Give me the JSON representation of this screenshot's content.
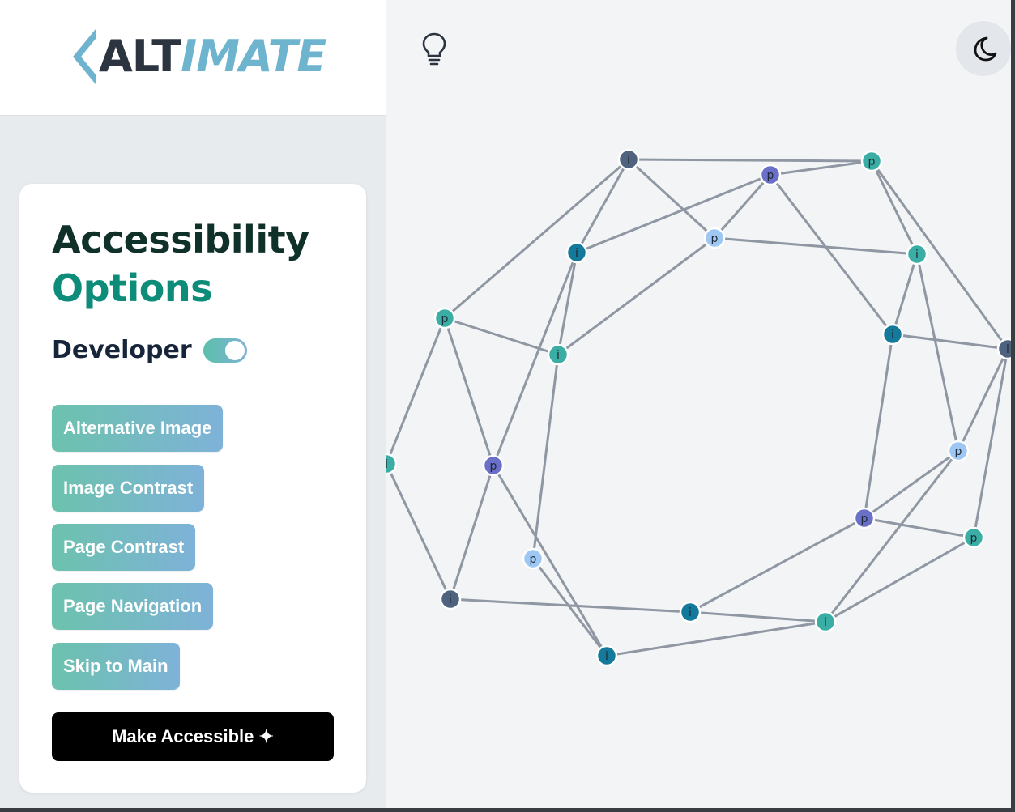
{
  "logo": {
    "text_dark": "ALT",
    "text_light": "IMATE",
    "icon": "chevron-left-icon"
  },
  "panel": {
    "title_line1": "Accessibility",
    "title_line2": "Options",
    "developer_label": "Developer",
    "developer_enabled": true,
    "options": [
      "Alternative Image",
      "Image Contrast",
      "Page Contrast",
      "Page Navigation",
      "Skip to Main"
    ],
    "make_accessible": "Make Accessible ✦"
  },
  "toolbar": {
    "hint_icon": "lightbulb-icon",
    "theme_icon": "moon-icon"
  },
  "colors": {
    "accent_teal": "#0e8c7a",
    "title_dark": "#10302a",
    "node_teal": "#3aaea4",
    "node_purple": "#6a6fc8",
    "node_light_blue": "#9ec8f3",
    "node_dark_slate": "#4f627e",
    "node_dark_teal": "#137a9c",
    "edge": "#8f97a3"
  },
  "graph": {
    "nodes": [
      {
        "label": "i",
        "color": "node_dark_slate"
      },
      {
        "label": "p",
        "color": "node_teal"
      },
      {
        "label": "p",
        "color": "node_purple"
      },
      {
        "label": "i",
        "color": "node_dark_teal"
      },
      {
        "label": "p",
        "color": "node_light_blue"
      },
      {
        "label": "i",
        "color": "node_teal"
      },
      {
        "label": "p",
        "color": "node_teal"
      },
      {
        "label": "i",
        "color": "node_teal"
      },
      {
        "label": "i",
        "color": "node_dark_teal"
      },
      {
        "label": "i",
        "color": "node_dark_slate"
      },
      {
        "label": "i",
        "color": "node_teal"
      },
      {
        "label": "p",
        "color": "node_purple"
      },
      {
        "label": "p",
        "color": "node_light_blue"
      },
      {
        "label": "p",
        "color": "node_purple"
      },
      {
        "label": "p",
        "color": "node_teal"
      },
      {
        "label": "p",
        "color": "node_light_blue"
      },
      {
        "label": "i",
        "color": "node_dark_slate"
      },
      {
        "label": "i",
        "color": "node_dark_teal"
      },
      {
        "label": "i",
        "color": "node_teal"
      },
      {
        "label": "i",
        "color": "node_dark_teal"
      }
    ]
  }
}
